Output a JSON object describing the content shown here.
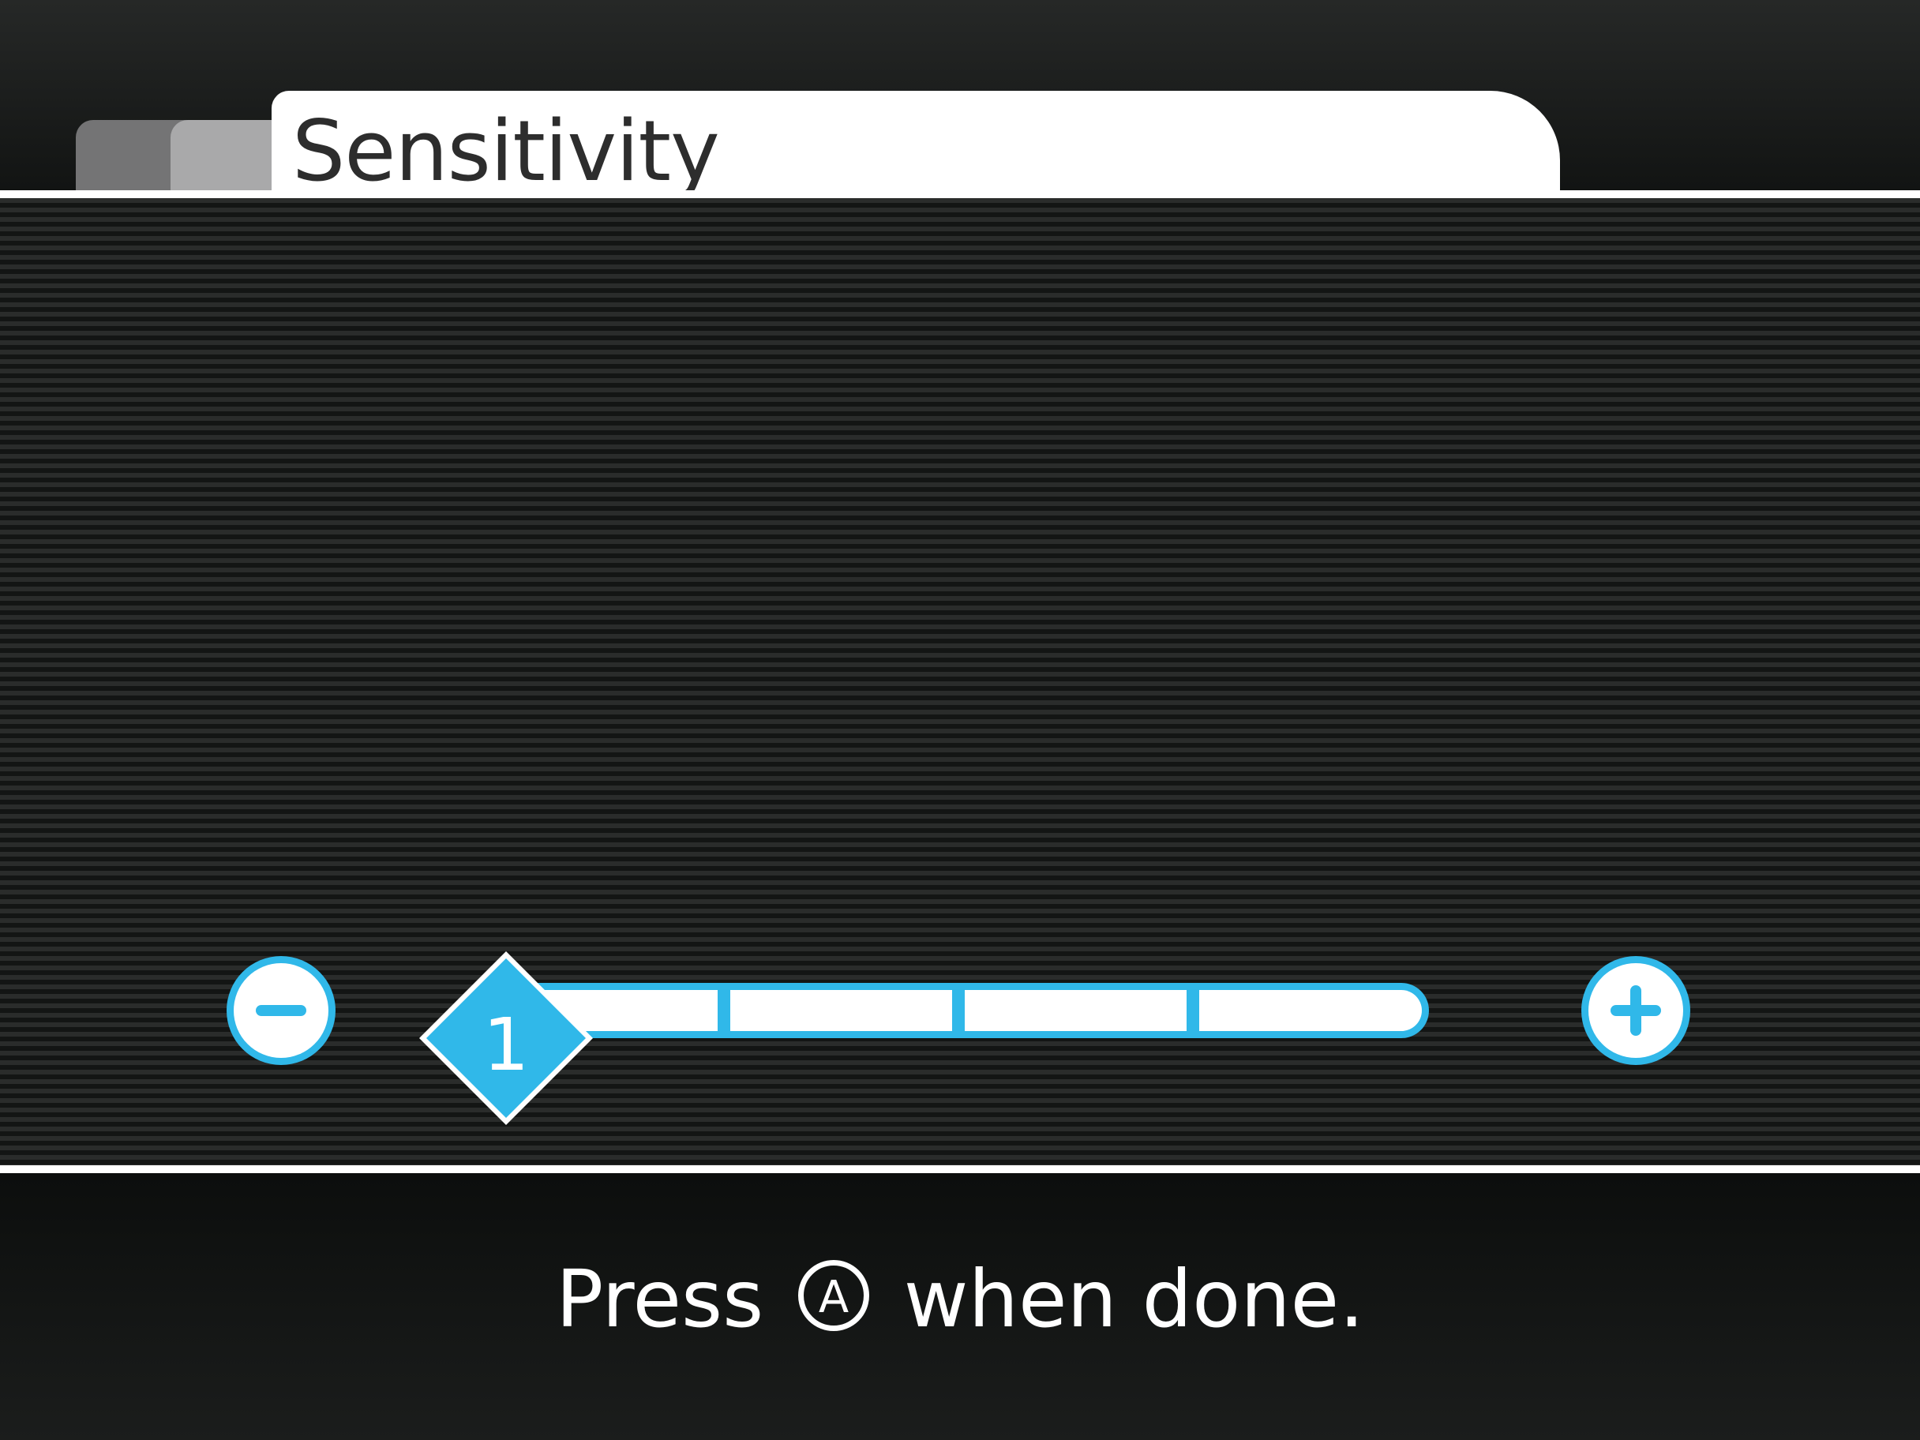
{
  "header": {
    "title": "Sensitivity"
  },
  "slider": {
    "value": "1",
    "min": 1,
    "max": 5,
    "steps": 5
  },
  "buttons": {
    "minus_icon": "minus-icon",
    "plus_icon": "plus-icon"
  },
  "footer": {
    "press_text": "Press",
    "button_letter": "A",
    "done_text": "when done."
  },
  "colors": {
    "accent": "#30b8e9",
    "tab_text": "#2d2d2d",
    "background": "#131514",
    "white": "#ffffff"
  }
}
